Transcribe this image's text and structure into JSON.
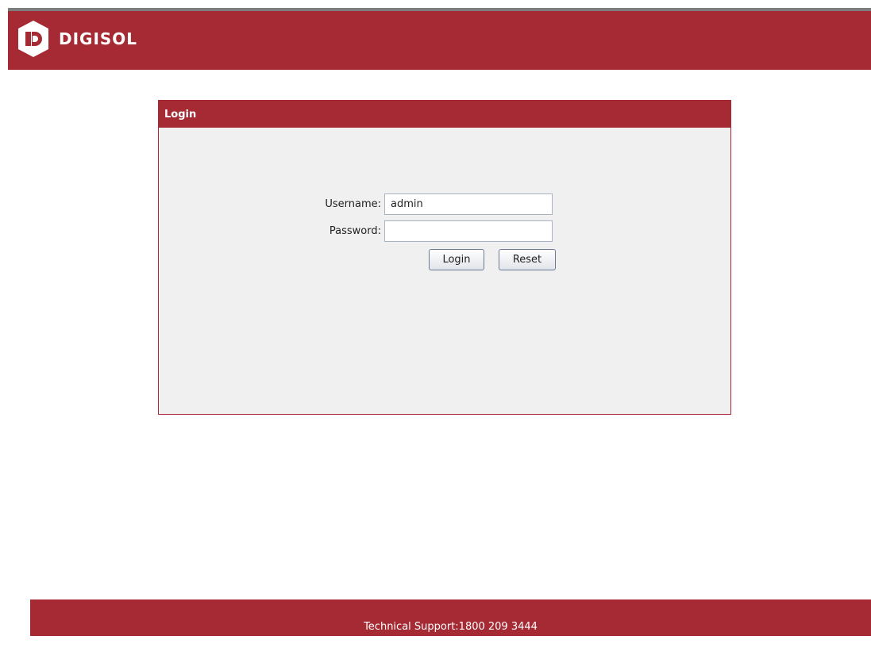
{
  "brand": {
    "name": "DIGISOL",
    "tm": "¯",
    "colors": {
      "primary": "#a52a33",
      "header_border": "#7d7d7d",
      "panel_bg": "#f0f0f0"
    },
    "icon": "digisol-d-logo-icon"
  },
  "login_panel": {
    "title": "Login",
    "username_label": "Username:",
    "username_value": "admin",
    "password_label": "Password:",
    "password_value": "",
    "login_button": "Login",
    "reset_button": "Reset"
  },
  "footer": {
    "support_text": "Technical Support:1800 209 3444"
  }
}
